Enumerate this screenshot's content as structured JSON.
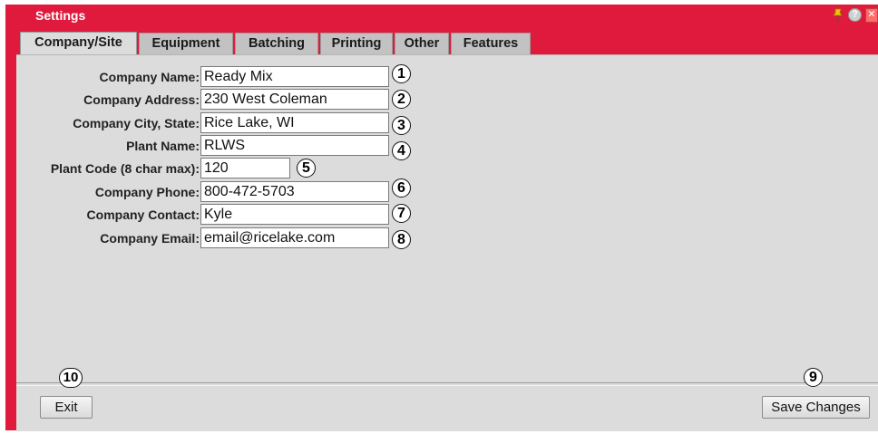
{
  "window": {
    "title": "Settings"
  },
  "titlebar_icons": [
    {
      "name": "pin-icon"
    },
    {
      "name": "help-icon",
      "glyph": "?"
    },
    {
      "name": "close-icon",
      "glyph": "✕"
    }
  ],
  "tabs": [
    {
      "label": "Company/Site",
      "active": true
    },
    {
      "label": "Equipment"
    },
    {
      "label": "Batching"
    },
    {
      "label": "Printing"
    },
    {
      "label": "Other"
    },
    {
      "label": "Features"
    }
  ],
  "form": {
    "fields": [
      {
        "label": "Company Name:",
        "value": "Ready Mix",
        "callout": "1"
      },
      {
        "label": "Company Address:",
        "value": "230 West Coleman",
        "callout": "2"
      },
      {
        "label": "Company City, State:",
        "value": "Rice Lake, WI",
        "callout": "3"
      },
      {
        "label": "Plant Name:",
        "value": "RLWS",
        "callout": "4"
      },
      {
        "label": "Plant Code (8 char max):",
        "value": "120",
        "callout": "5"
      },
      {
        "label": "Company Phone:",
        "value": "800-472-5703",
        "callout": "6"
      },
      {
        "label": "Company Contact:",
        "value": "Kyle",
        "callout": "7"
      },
      {
        "label": "Company Email:",
        "value": "email@ricelake.com",
        "callout": "8"
      }
    ]
  },
  "footer": {
    "exit_label": "Exit",
    "exit_callout": "10",
    "save_label": "Save Changes",
    "save_callout": "9"
  },
  "colors": {
    "titlebar": "#e01a3c",
    "panel": "#dcdcdc",
    "tab": "#c2c2c2"
  }
}
